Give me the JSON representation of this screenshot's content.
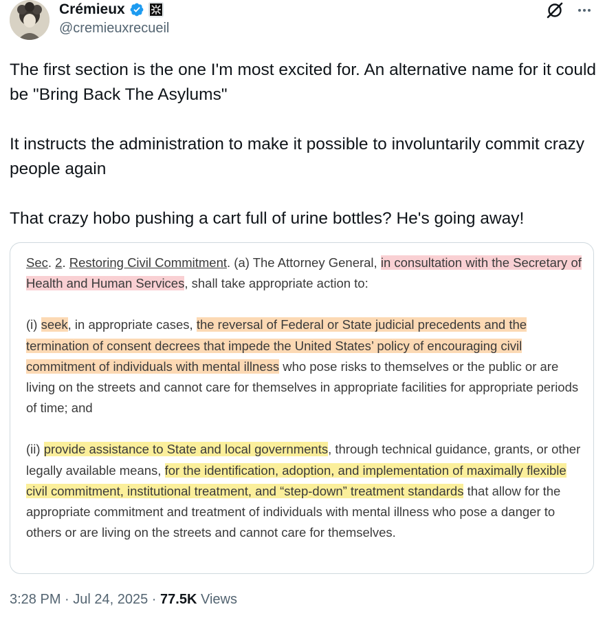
{
  "author": {
    "name": "Crémieux",
    "handle": "@cremieuxrecueil"
  },
  "icons": {
    "verified": "verified-badge-icon",
    "affiliate": "affiliate-badge-icon",
    "grok": "grok-icon",
    "more": "more-icon"
  },
  "colors": {
    "verified": "#1d9bf0",
    "highlight_red": "#f9d0d3",
    "highlight_orange": "#fcd9b4",
    "highlight_yellow": "#fbef9b"
  },
  "tweet": {
    "paragraphs": [
      "The first section is the one I'm most excited for. An alternative name for it could be \"Bring Back The Asylums\"",
      "It instructs the administration to make it possible to involuntarily commit crazy people again",
      "That crazy hobo pushing a cart full of urine bottles? He's going away!"
    ]
  },
  "document": {
    "p1": {
      "sec_label": "Sec",
      "sec_dot": ". ",
      "sec_num": "2",
      "sec_dot2": ".  ",
      "sec_title": "Restoring Civil Commitment",
      "lead": ".  (a)  The Attorney General, ",
      "hl_red": "in consultation with the Secretary of Health and Human Services",
      "tail": ", shall take appropriate action to:"
    },
    "p2": {
      "marker": "(i)  ",
      "hl1": "seek",
      "mid": ", in appropriate cases, ",
      "hl2": "the reversal of Federal or State judicial precedents and the termination of consent decrees that impede the United States’ policy of encouraging civil commitment of individuals with mental illness",
      "tail": " who pose risks to themselves or the public or are living on the streets and cannot care for themselves in appropriate facilities for appropriate periods of time; and"
    },
    "p3": {
      "marker": "(ii)  ",
      "hl1": "provide assistance to State and local governments",
      "mid": ", through technical guidance, grants, or other legally available means, ",
      "hl2": "for the identification, adoption, and implementation of maximally flexible civil commitment, institutional treatment, and “step-down” treatment standards",
      "tail": " that allow for the appropriate commitment and treatment of individuals with mental illness who pose a danger to others or are living on the streets and cannot care for themselves."
    }
  },
  "meta": {
    "time": "3:28 PM",
    "sep1": " · ",
    "date": "Jul 24, 2025",
    "sep2": " · ",
    "views_count": "77.5K",
    "views_label": " Views"
  }
}
